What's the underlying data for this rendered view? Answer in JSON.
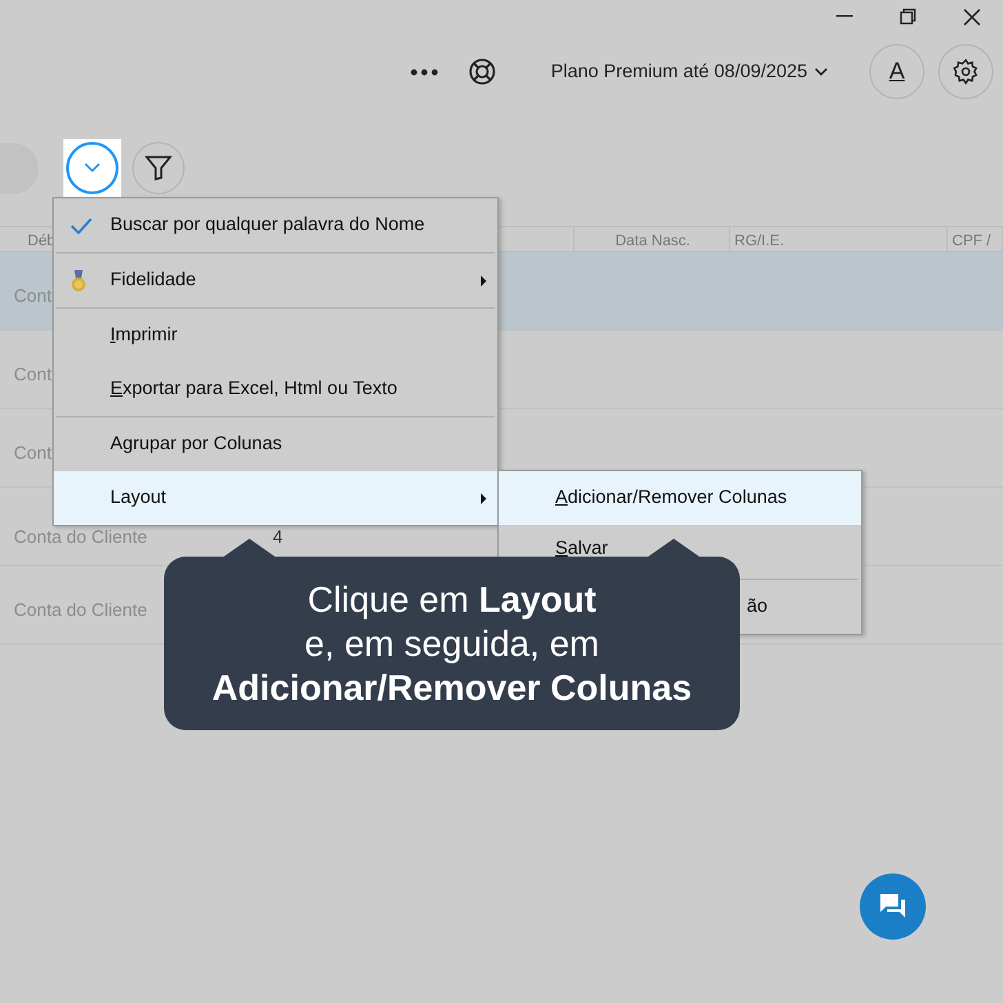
{
  "header": {
    "plan_label": "Plano Premium até 08/09/2025",
    "account_button": "A"
  },
  "toolbar": {
    "dropdown_highlighted": true
  },
  "table": {
    "columns": [
      {
        "label": "Déb"
      },
      {
        "label": "Data Nasc."
      },
      {
        "label": "RG/I.E."
      },
      {
        "label": "CPF /"
      }
    ],
    "rows": [
      {
        "cells": [
          "Cont"
        ],
        "selected": true
      },
      {
        "cells": [
          "Cont"
        ],
        "selected": false
      },
      {
        "cells": [
          "Cont"
        ],
        "selected": false
      },
      {
        "cells": [
          "Conta do Cliente",
          "4"
        ],
        "selected": false
      },
      {
        "cells": [
          "Conta do Cliente"
        ],
        "selected": false
      }
    ]
  },
  "menu": {
    "items": [
      {
        "kind": "check",
        "label": "Buscar por qualquer palavra do Nome",
        "checked": true,
        "submenu": false,
        "selected": false,
        "underline_first": false
      },
      {
        "kind": "separator"
      },
      {
        "kind": "medal",
        "label": "Fidelidade",
        "submenu": true,
        "selected": false,
        "underline_first": false
      },
      {
        "kind": "separator"
      },
      {
        "kind": "plain",
        "label": "Imprimir",
        "submenu": false,
        "selected": false,
        "underline_first": true
      },
      {
        "kind": "plain",
        "label": "Exportar para Excel, Html ou Texto",
        "submenu": false,
        "selected": false,
        "underline_first": true
      },
      {
        "kind": "separator"
      },
      {
        "kind": "plain",
        "label": "Agrupar por Colunas",
        "submenu": false,
        "selected": false,
        "underline_first": false
      },
      {
        "kind": "plain",
        "label": "Layout",
        "submenu": true,
        "selected": true,
        "underline_first": false
      }
    ]
  },
  "submenu": {
    "items": [
      {
        "kind": "plain",
        "label": "Adicionar/Remover Colunas",
        "selected": true,
        "underline_first": true
      },
      {
        "kind": "plain",
        "label": "Salvar",
        "selected": false,
        "underline_first": true
      },
      {
        "kind": "separator"
      },
      {
        "kind": "tail",
        "label": "ão",
        "selected": false,
        "underline_first": false
      }
    ]
  },
  "tooltip": {
    "text": "Clique em **Layout**\ne, em seguida, em\n**Adicionar/Remover Colunas**"
  }
}
